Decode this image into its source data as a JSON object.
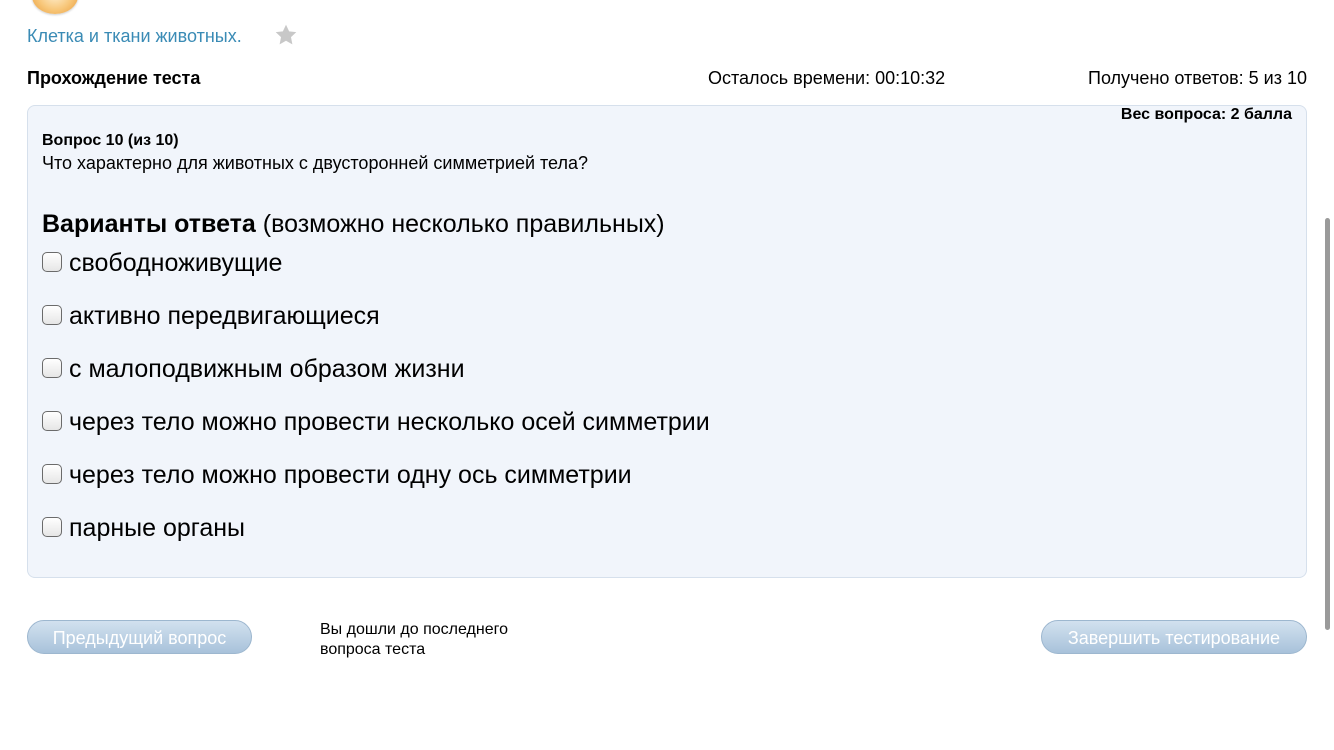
{
  "topic": {
    "link_text": "Клетка и ткани животных.",
    "top_icon": "document-icon",
    "star_icon": "star-icon"
  },
  "header": {
    "title": "Прохождение теста",
    "timer": "Осталось времени: 00:10:32",
    "answers_count": "Получено ответов: 5 из 10"
  },
  "question": {
    "weight": "Вес вопроса: 2 балла",
    "number": "Вопрос 10 (из 10)",
    "text": "Что характерно для животных с двусторонней симметрией тела?",
    "options_heading_bold": "Варианты ответа",
    "options_heading_rest": " (возможно несколько правильных)",
    "options": [
      {
        "label": "свободноживущие",
        "checked": false
      },
      {
        "label": "активно передвигающиеся",
        "checked": false
      },
      {
        "label": "с малоподвижным образом жизни",
        "checked": false
      },
      {
        "label": "через тело можно провести несколько осей симметрии",
        "checked": false
      },
      {
        "label": "через тело можно провести одну ось симметрии",
        "checked": false
      },
      {
        "label": "парные органы",
        "checked": false
      }
    ]
  },
  "footer": {
    "prev_button": "Предыдущий вопрос",
    "last_note": "Вы дошли до последнего вопроса теста",
    "finish_button": "Завершить тестирование"
  },
  "colors": {
    "link": "#3a8bb5",
    "panel_bg": "#f1f5fb",
    "button_bg": "#b9cfe3"
  }
}
